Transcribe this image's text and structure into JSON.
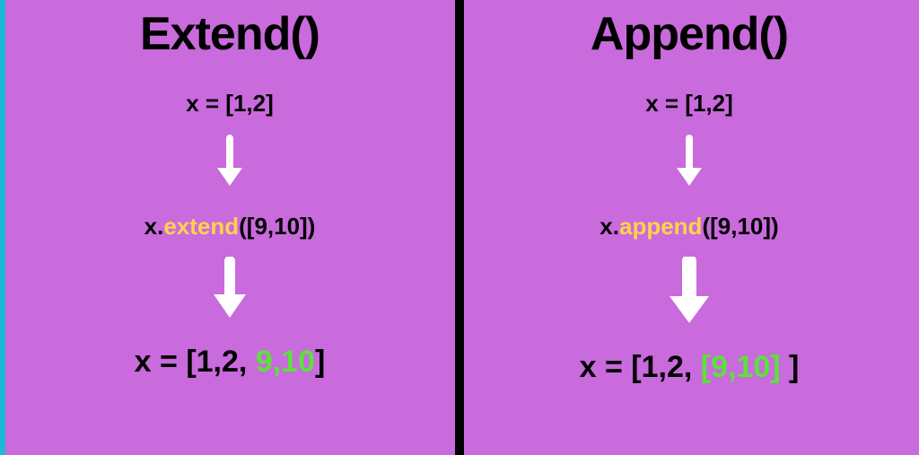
{
  "colors": {
    "background": "#c96add",
    "accent_edge": "#1eb8d8",
    "divider": "#000000",
    "text": "#000000",
    "method_highlight": "#ffd24a",
    "added_highlight": "#5be23a",
    "arrow": "#ffffff"
  },
  "left": {
    "title": "Extend()",
    "initial": "x = [1,2]",
    "operation": {
      "prefix": "x.",
      "method": "extend",
      "args": "([9,10])"
    },
    "result": {
      "prefix": "x = [1,2, ",
      "added": "9,10",
      "suffix": "]"
    }
  },
  "right": {
    "title": "Append()",
    "initial": "x = [1,2]",
    "operation": {
      "prefix": "x.",
      "method": "append",
      "args": "([9,10])"
    },
    "result": {
      "prefix": "x = [1,2, ",
      "added": "[9,10]",
      "suffix": " ]"
    }
  }
}
